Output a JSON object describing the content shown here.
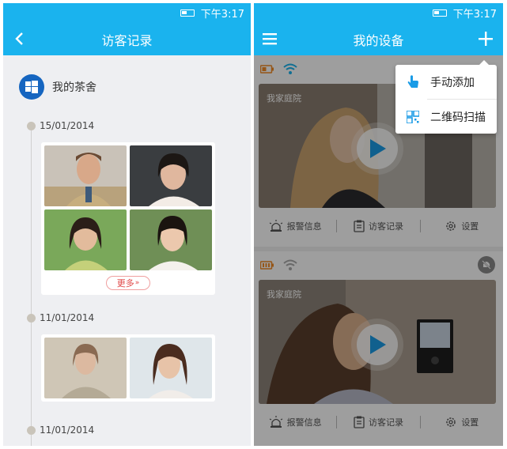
{
  "left_screen": {
    "status_time": "下午3:17",
    "title": "访客记录",
    "owner_name": "我的茶舍",
    "groups": [
      {
        "date": "15/01/2014",
        "more_label": "更多"
      },
      {
        "date": "11/01/2014"
      },
      {
        "date": "11/01/2014"
      }
    ]
  },
  "right_screen": {
    "status_time": "下午3:17",
    "title": "我的设备",
    "menu": {
      "items": [
        {
          "label": "手动添加",
          "icon": "hand-pointer-icon"
        },
        {
          "label": "二维码扫描",
          "icon": "qr-code-icon"
        }
      ]
    },
    "devices": [
      {
        "location": "我家庭院",
        "alarm_label": "报警信息",
        "visitor_label": "访客记录",
        "settings_label": "设置"
      },
      {
        "location": "我家庭院",
        "alarm_label": "报警信息",
        "visitor_label": "访客记录",
        "settings_label": "设置"
      }
    ]
  },
  "colors": {
    "accent": "#1ab3ee",
    "play": "#1a9be6",
    "more_text": "#e04848"
  }
}
